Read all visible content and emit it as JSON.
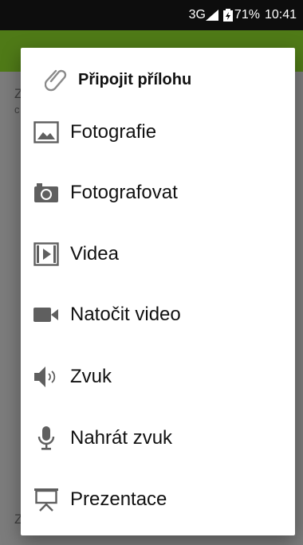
{
  "status": {
    "network": "3G",
    "battery": "71%",
    "time": "10:41"
  },
  "underlay": {
    "left_letters": [
      "Z",
      "c",
      "Z"
    ]
  },
  "dialog": {
    "title": "Připojit přílohu",
    "items": [
      {
        "label": "Fotografie",
        "icon": "image-icon"
      },
      {
        "label": "Fotografovat",
        "icon": "camera-icon"
      },
      {
        "label": "Videa",
        "icon": "film-icon"
      },
      {
        "label": "Natočit video",
        "icon": "videocam-icon"
      },
      {
        "label": "Zvuk",
        "icon": "speaker-icon"
      },
      {
        "label": "Nahrát zvuk",
        "icon": "microphone-icon"
      },
      {
        "label": "Prezentace",
        "icon": "presentation-icon"
      }
    ]
  },
  "colors": {
    "appbar": "#4f7a17",
    "statusbar": "#0d0d0d",
    "icon": "#5f5f5f"
  }
}
